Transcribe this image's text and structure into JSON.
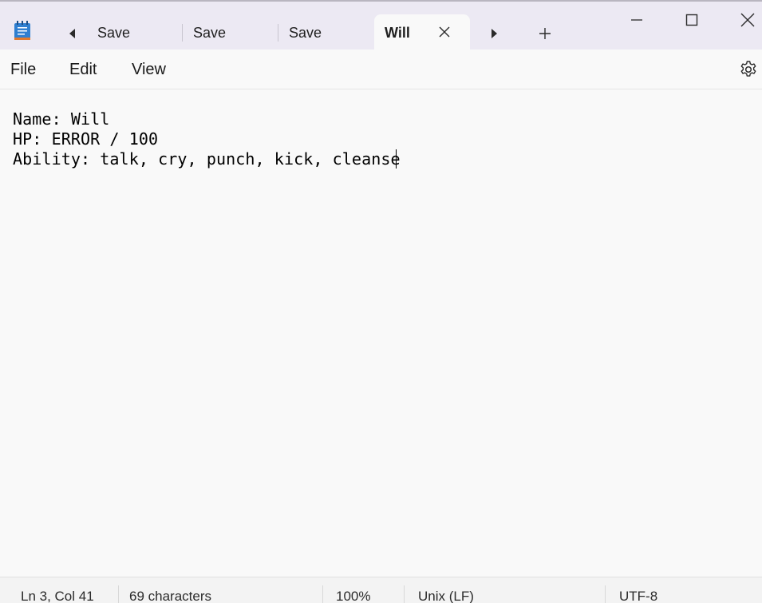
{
  "titlebar": {
    "app_icon": "notepad-icon",
    "tabs": [
      {
        "label": "Save",
        "active": false
      },
      {
        "label": "Save",
        "active": false
      },
      {
        "label": "Save",
        "active": false
      },
      {
        "label": "Will",
        "active": true
      }
    ],
    "icons": {
      "scroll_left": "caret-left-icon",
      "scroll_right": "caret-right-icon",
      "new_tab": "plus-icon",
      "close_tab": "close-icon",
      "minimize": "minimize-icon",
      "maximize": "maximize-icon",
      "close_window": "close-icon"
    }
  },
  "menu": {
    "file": "File",
    "edit": "Edit",
    "view": "View",
    "settings_icon": "gear-icon"
  },
  "editor": {
    "lines": [
      "Name: Will",
      "HP: ERROR / 100",
      "Ability: talk, cry, punch, kick, cleanse"
    ]
  },
  "status": {
    "position": "Ln 3, Col 41",
    "characters": "69 characters",
    "zoom": "100%",
    "line_endings": "Unix (LF)",
    "encoding": "UTF-8"
  },
  "colors": {
    "titlebar_bg": "#ece9f3",
    "editor_bg": "#f9f9f9",
    "status_bg": "#f3f3f3",
    "notepad_icon_blue": "#2f7fd0",
    "notepad_icon_orange": "#e2792c"
  }
}
